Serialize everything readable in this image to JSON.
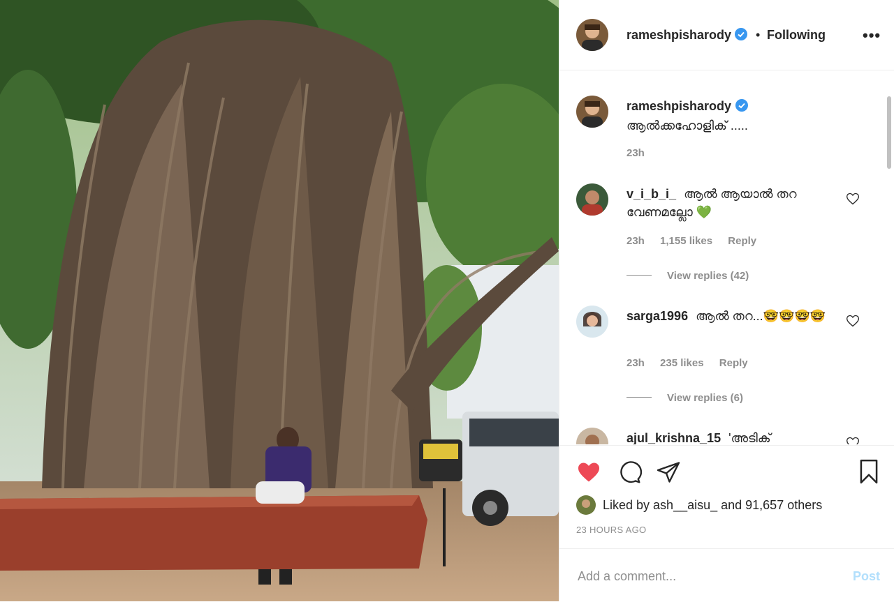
{
  "post": {
    "username": "rameshpisharody",
    "follow_dot": "•",
    "follow_label": "Following",
    "more_label": "•••",
    "caption": "ആൽക്കഹോളിക് .....",
    "caption_time": "23h"
  },
  "comments": [
    {
      "username": "v_i_b_i_",
      "text": "ആൽ ആയാൽ തറ വേണമല്ലോ 💚",
      "time": "23h",
      "likes": "1,155 likes",
      "reply": "Reply",
      "view_replies": "View replies (42)"
    },
    {
      "username": "sarga1996",
      "text": "ആൽ തറ...🤓🤓🤓🤓",
      "time": "23h",
      "likes": "235 likes",
      "reply": "Reply",
      "view_replies": "View replies (6)"
    },
    {
      "username": "ajul_krishna_15",
      "text": "'അടിക്",
      "time": "",
      "likes": "",
      "reply": "",
      "view_replies": ""
    }
  ],
  "actions": {
    "liked_by": "Liked by ash__aisu_ and 91,657 others",
    "time_ago": "23 HOURS AGO"
  },
  "add_comment": {
    "placeholder": "Add a comment...",
    "post_label": "Post"
  },
  "icons": [
    "heart-icon",
    "comment-icon",
    "share-icon",
    "bookmark-icon",
    "verified-icon",
    "more-icon"
  ],
  "colors": {
    "like_red": "#ed4956",
    "verified_blue": "#3897f0",
    "post_blue_disabled": "#b2dffc",
    "emoji_green": "#2eb82e"
  }
}
